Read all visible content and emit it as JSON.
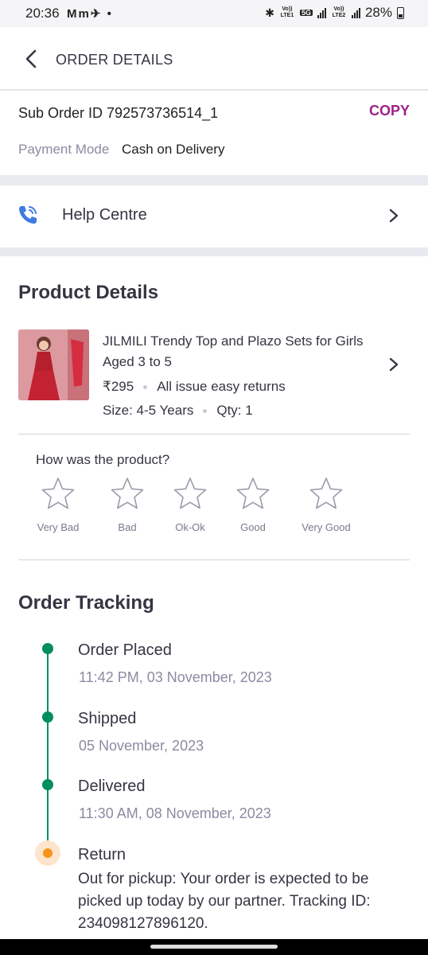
{
  "status_bar": {
    "time": "20:36",
    "left_icons": "Mm✈ •",
    "bluetooth": "✱",
    "net1": "Vo)) LTE1",
    "net_5g": "5G",
    "net2": "Vo)) LTE2",
    "battery": "28%"
  },
  "header": {
    "title": "ORDER DETAILS",
    "back_icon": "chevron-left-icon"
  },
  "order": {
    "suborder_id": "Sub Order ID 792573736514_1",
    "copy_label": "COPY",
    "payment_label": "Payment Mode",
    "payment_value": "Cash on Delivery",
    "accent_color": "#9f2089"
  },
  "help": {
    "label": "Help Centre",
    "icon": "phone-icon"
  },
  "product_section": {
    "title": "Product Details",
    "name": "JILMILI Trendy Top and Plazo Sets for Girls Aged 3 to 5",
    "price": "₹295",
    "returns": "All issue easy returns",
    "size": "Size: 4-5 Years",
    "qty": "Qty: 1"
  },
  "rating": {
    "question": "How was the product?",
    "options": [
      "Very Bad",
      "Bad",
      "Ok-Ok",
      "Good",
      "Very Good"
    ]
  },
  "tracking": {
    "title": "Order Tracking",
    "status_color": "#038d63",
    "pending_color": "#f7931a",
    "steps": [
      {
        "title": "Order Placed",
        "time": "11:42 PM, 03 November, 2023"
      },
      {
        "title": "Shipped",
        "time": "05 November, 2023"
      },
      {
        "title": "Delivered",
        "time": "11:30 AM, 08 November, 2023"
      },
      {
        "title": "Return",
        "desc": "Out for pickup: Your order is expected to be picked up today by our partner. Tracking ID: 234098127896120."
      }
    ]
  }
}
